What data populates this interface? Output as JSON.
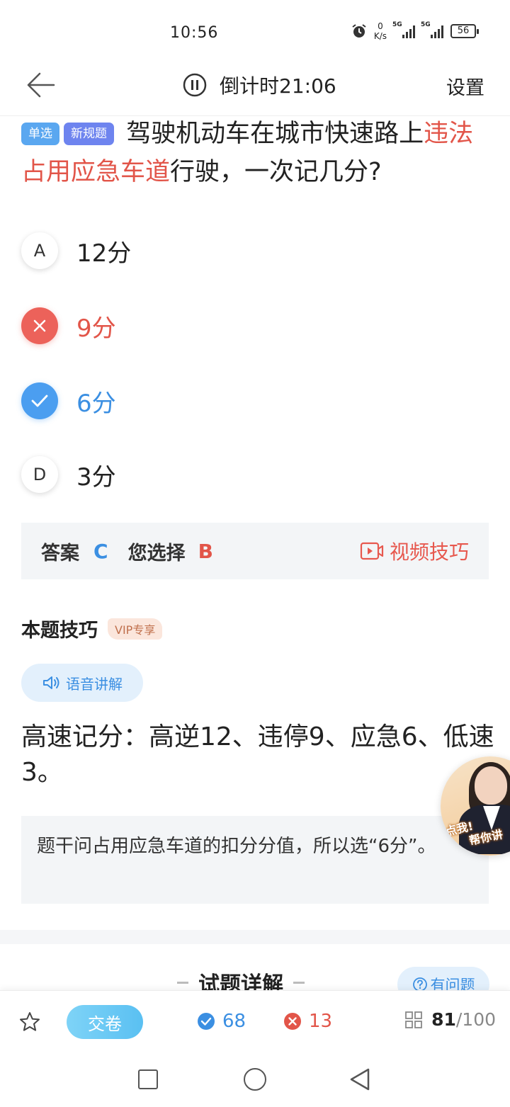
{
  "status_bar": {
    "time": "10:56",
    "net_speed_value": "0",
    "net_speed_unit": "K/s",
    "signal1_label": "5G",
    "signal2_label": "5G",
    "battery": "56"
  },
  "header": {
    "timer_label": "倒计时21:06",
    "settings_label": "设置"
  },
  "question": {
    "tag_type": "单选",
    "tag_new": "新规题",
    "text_before": "驾驶机动车在城市快速路上",
    "text_highlight": "违法占用应急车道",
    "text_after": "行驶，一次记几分?"
  },
  "options": [
    {
      "letter": "A",
      "text": "12分",
      "state": "normal"
    },
    {
      "letter": "B",
      "text": "9分",
      "state": "wrong"
    },
    {
      "letter": "C",
      "text": "6分",
      "state": "correct"
    },
    {
      "letter": "D",
      "text": "3分",
      "state": "normal"
    }
  ],
  "answer_bar": {
    "answer_label": "答案",
    "answer_value": "C",
    "chosen_label": "您选择",
    "chosen_value": "B",
    "video_tip_label": "视频技巧"
  },
  "skill": {
    "title": "本题技巧",
    "vip_badge": "VIP专享",
    "voice_label": "语音讲解",
    "text": "高速记分：高逆12、违停9、应急6、低速3。",
    "explanation": "题干问占用应急车道的扣分分值，所以选“6分”。"
  },
  "helper": {
    "line1": "点我!",
    "line2": "帮你讲"
  },
  "detail": {
    "title": "试题详解",
    "ask_label": "有问题"
  },
  "bottom_bar": {
    "submit_label": "交卷",
    "correct_count": "68",
    "wrong_count": "13",
    "progress_current": "81",
    "progress_total": "/100"
  },
  "colors": {
    "accent_blue": "#3b8fe2",
    "accent_red": "#e25549",
    "panel_gray": "#f3f5f7"
  },
  "icons": [
    "alarm-icon",
    "back-arrow-icon",
    "pause-icon",
    "close-icon",
    "check-icon",
    "video-icon",
    "speaker-icon",
    "question-icon",
    "star-icon",
    "grid-icon"
  ]
}
